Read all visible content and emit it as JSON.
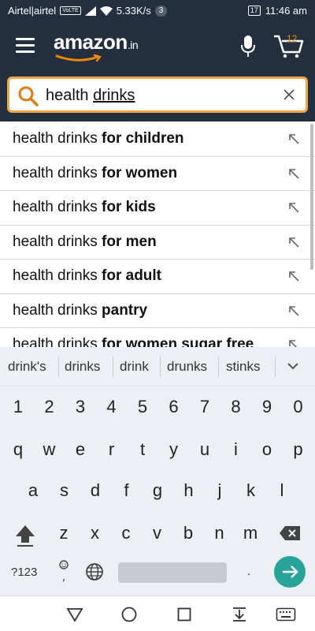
{
  "status_bar": {
    "carrier": "Airtel|airtel",
    "volte": "VoLTE",
    "speed": "5.33K/s",
    "notifications": "3",
    "battery": "17",
    "time": "11:46 am"
  },
  "header": {
    "logo_text": "amazon",
    "logo_suffix": ".in",
    "cart_count": "12",
    "accent_color": "#f08804",
    "bg_color": "#232f3e"
  },
  "search": {
    "value_prefix": "health ",
    "value_underlined": "drinks",
    "border_color": "#f0a54a"
  },
  "suggestions": [
    {
      "prefix": "health drinks ",
      "bold": "for children"
    },
    {
      "prefix": "health drinks ",
      "bold": "for women"
    },
    {
      "prefix": "health drinks ",
      "bold": "for kids"
    },
    {
      "prefix": "health drinks ",
      "bold": "for men"
    },
    {
      "prefix": "health drinks ",
      "bold": "for adult"
    },
    {
      "prefix": "health drinks ",
      "bold": "pantry"
    },
    {
      "prefix": "health drinks ",
      "bold": "for women sugar free"
    }
  ],
  "keyboard": {
    "predictions": [
      "drink's",
      "drinks",
      "drink",
      "drunks",
      "stinks"
    ],
    "row_numbers": [
      "1",
      "2",
      "3",
      "4",
      "5",
      "6",
      "7",
      "8",
      "9",
      "0"
    ],
    "row_1": [
      "q",
      "w",
      "e",
      "r",
      "t",
      "y",
      "u",
      "i",
      "o",
      "p"
    ],
    "row_2": [
      "a",
      "s",
      "d",
      "f",
      "g",
      "h",
      "j",
      "k",
      "l"
    ],
    "row_3": [
      "z",
      "x",
      "c",
      "v",
      "b",
      "n",
      "m"
    ],
    "symbols_label": "?123",
    "period": ".",
    "enter_color": "#27a39a"
  }
}
